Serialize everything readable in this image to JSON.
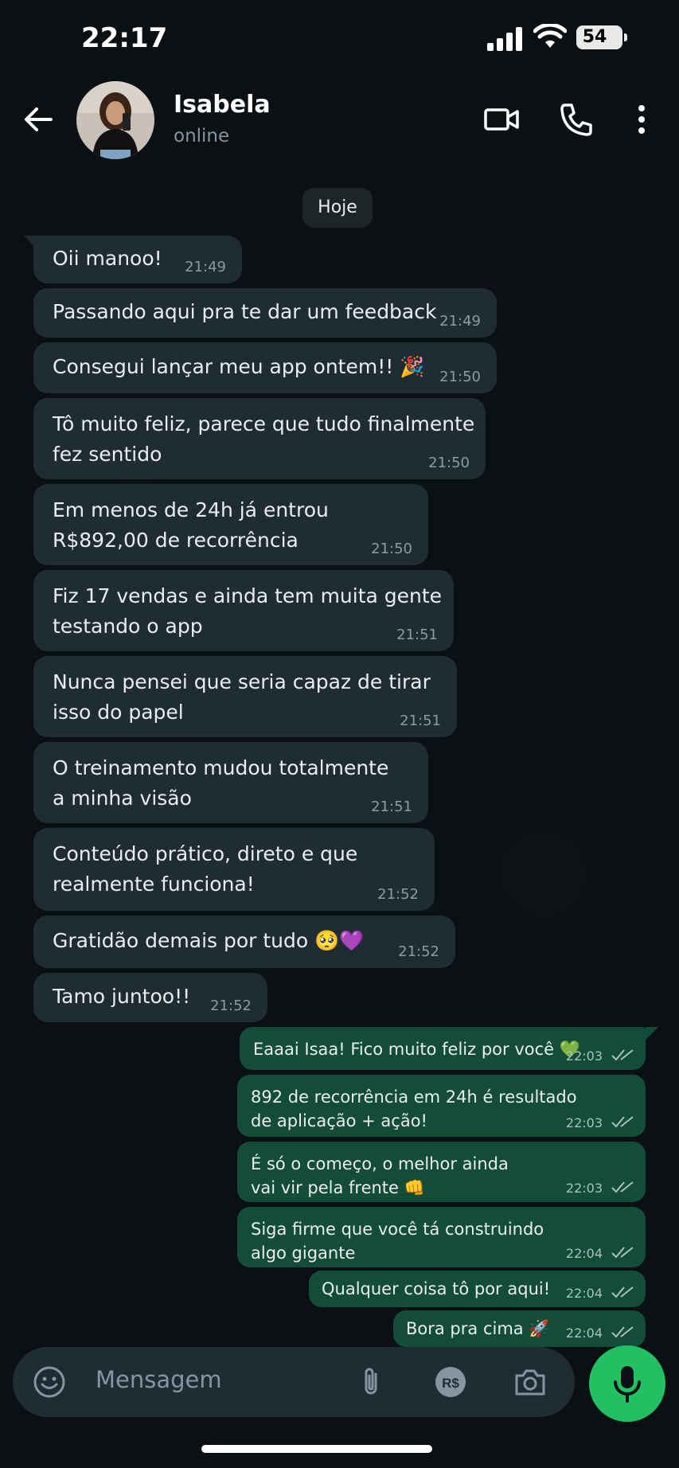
{
  "status_bar": {
    "time": "22:17",
    "battery": "54"
  },
  "header": {
    "contact_name": "Isabela",
    "contact_status": "online"
  },
  "chat": {
    "day_label": "Hoje",
    "incoming": [
      {
        "text": "Oii manoo!",
        "time": "21:49"
      },
      {
        "text": "Passando aqui pra te dar um feedback",
        "time": "21:49"
      },
      {
        "text": "Consegui lançar meu app ontem!! 🎉",
        "time": "21:50"
      },
      {
        "text_line1": "Tô muito feliz, parece que tudo finalmente",
        "text_line2": "fez sentido",
        "time": "21:50"
      },
      {
        "text_line1": "Em menos de 24h já entrou",
        "text_line2": "R$892,00 de recorrência",
        "time": "21:50"
      },
      {
        "text_line1": "Fiz 17 vendas e ainda tem muita gente",
        "text_line2": "testando o app",
        "time": "21:51"
      },
      {
        "text_line1": "Nunca pensei que seria capaz de tirar",
        "text_line2": "isso do papel",
        "time": "21:51"
      },
      {
        "text_line1": "O treinamento mudou totalmente",
        "text_line2": "a minha visão",
        "time": "21:51"
      },
      {
        "text_line1": "Conteúdo prático, direto e que",
        "text_line2": "realmente funciona!",
        "time": "21:52"
      },
      {
        "text": "Gratidão demais por tudo 🥺💜",
        "time": "21:52"
      },
      {
        "text": "Tamo juntoo!!",
        "time": "21:52"
      }
    ],
    "outgoing": [
      {
        "text": "Eaaai Isaa! Fico muito feliz por você 💚",
        "time": "22:03"
      },
      {
        "text_line1": "892 de recorrência em 24h é resultado",
        "text_line2": "de aplicação + ação!",
        "time": "22:03"
      },
      {
        "text_line1": "É só o começo, o melhor ainda",
        "text_line2": "vai vir pela frente 👊",
        "time": "22:03"
      },
      {
        "text_line1": "Siga firme que você tá construindo",
        "text_line2": "algo gigante",
        "time": "22:04"
      },
      {
        "text": "Qualquer coisa tô por aqui!",
        "time": "22:04"
      },
      {
        "text": "Bora pra cima 🚀",
        "time": "22:04"
      }
    ]
  },
  "composer": {
    "placeholder": "Mensagem"
  },
  "icons": {
    "back": "arrow-left-icon",
    "video_call": "video-camera-icon",
    "voice_call": "phone-icon",
    "menu": "more-vertical-icon",
    "emoji": "emoji-icon",
    "attach": "paperclip-icon",
    "payment": "real-currency-icon",
    "camera": "camera-icon",
    "mic": "microphone-icon"
  },
  "colors": {
    "background": "#0b1014",
    "incoming_bubble": "#1f2c33",
    "outgoing_bubble": "#144d37",
    "accent_green": "#21c063",
    "read_ticks": "#a7c3b8"
  }
}
